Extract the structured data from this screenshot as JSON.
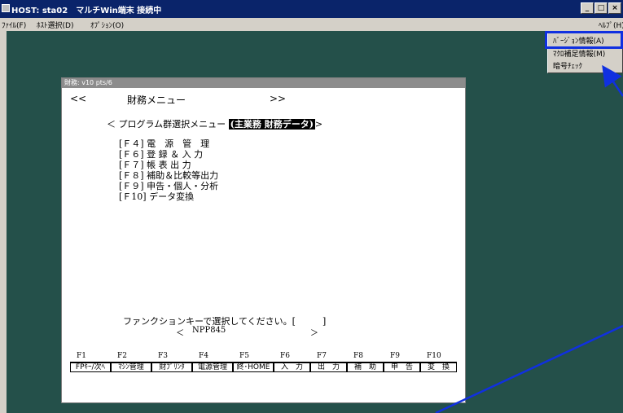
{
  "window": {
    "title": "HOST: sta02　マルチWin端末 接続中",
    "buttons": [
      "_",
      "□",
      "×"
    ]
  },
  "menubar": {
    "items": [
      "ﾌｧｲﾙ(F)",
      "ﾎｽﾄ選択(D)",
      "ｵﾌﾟｼｮﾝ(O)"
    ],
    "help": "ﾍﾙﾌﾟ(H)"
  },
  "help_menu": {
    "items": [
      "ﾊﾞｰｼﾞｮﾝ情報(A)",
      "ﾏｸﾛ補足情報(M)",
      "暗号ﾁｪｯｸ"
    ],
    "highlighted": "ﾊﾞｰｼﾞｮﾝ情報(A)"
  },
  "terminal": {
    "title": "財務: v10 pts/6",
    "header_left": "<<",
    "header_title": "財務メニュー",
    "header_right": ">>",
    "menu_title": "＜ プログラム群選択メニュー",
    "menu_tag": "(主業務 財務データ)",
    "menu_close": ">",
    "options": [
      "[Ｆ４] 電　源　管　理",
      "[Ｆ６] 登 録 ＆ 入 力",
      "[Ｆ７] 帳 表 出 力",
      "[Ｆ８] 補助＆比較等出力",
      "[Ｆ９] 申告・個人・分析",
      "[Ｆ10] データ変換"
    ],
    "prompt": "ファンクションキーで選択してください。[　　　]",
    "prompt_sub_left": "＜",
    "prompt_code": "NPP845",
    "prompt_sub_right": "＞",
    "fkey_numbers": [
      "F1",
      "F2",
      "F3",
      "F4",
      "F5",
      "F6",
      "F7",
      "F8",
      "F9",
      "F10"
    ],
    "fkey_labels": [
      "FPｷｰ/次ﾍ",
      "ﾏｼﾝ管理",
      "財ﾌﾟﾘﾝﾀ",
      "電源管理",
      "終･HOME",
      "入　力",
      "出　力",
      "補　助",
      "申　告",
      "変　換"
    ]
  }
}
